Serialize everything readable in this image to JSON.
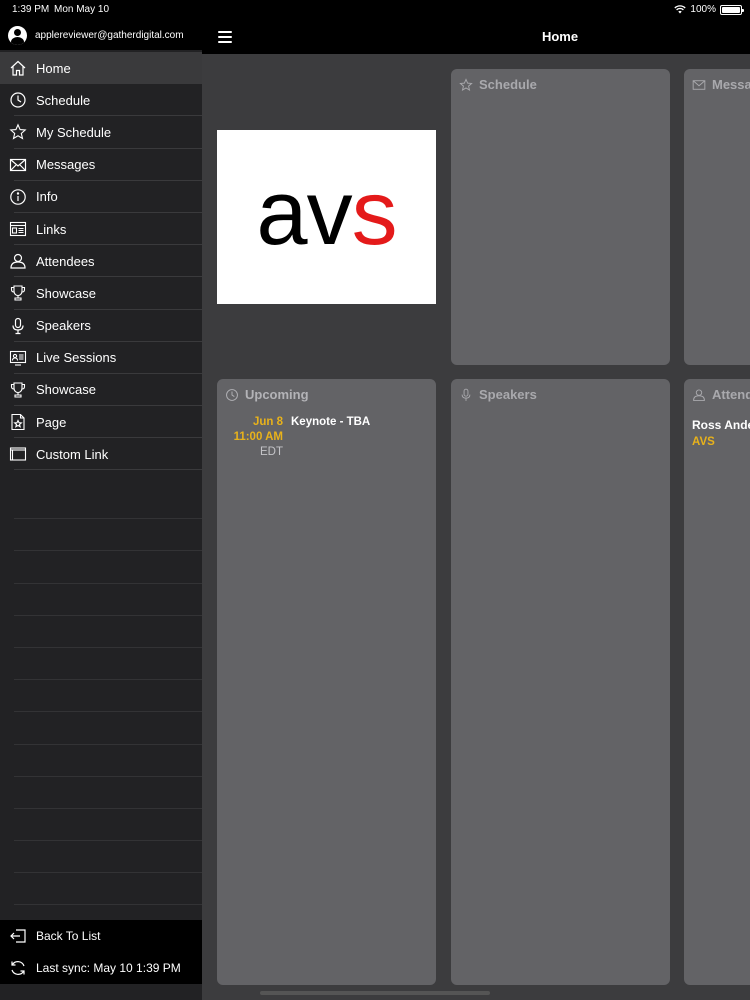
{
  "status_bar": {
    "time": "1:39 PM",
    "date": "Mon May 10",
    "battery": "100%",
    "battery_level": 1.0
  },
  "account": {
    "email": "applereviewer@gatherdigital.com"
  },
  "sidebar": {
    "items": [
      {
        "label": "Home",
        "icon": "home-icon"
      },
      {
        "label": "Schedule",
        "icon": "clock-icon"
      },
      {
        "label": "My Schedule",
        "icon": "star-icon"
      },
      {
        "label": "Messages",
        "icon": "envelope-icon"
      },
      {
        "label": "Info",
        "icon": "info-icon"
      },
      {
        "label": "Links",
        "icon": "links-icon"
      },
      {
        "label": "Attendees",
        "icon": "person-icon"
      },
      {
        "label": "Showcase",
        "icon": "trophy-icon"
      },
      {
        "label": "Speakers",
        "icon": "microphone-icon"
      },
      {
        "label": "Live Sessions",
        "icon": "presentation-icon"
      },
      {
        "label": "Showcase",
        "icon": "trophy-icon"
      },
      {
        "label": "Page",
        "icon": "page-icon"
      },
      {
        "label": "Custom Link",
        "icon": "window-icon"
      }
    ],
    "back_to_list": "Back To List",
    "last_sync_label": "Last sync:",
    "last_sync_value": "May 10 1:39 PM"
  },
  "header": {
    "title": "Home"
  },
  "logo": {
    "part1": "av",
    "part2": "s"
  },
  "cards": {
    "schedule": {
      "title": "Schedule"
    },
    "messages": {
      "title": "Messages"
    },
    "upcoming": {
      "title": "Upcoming",
      "events": [
        {
          "date": "Jun 8",
          "time": "11:00 AM",
          "tz": "EDT",
          "title": "Keynote - TBA"
        }
      ]
    },
    "speakers": {
      "title": "Speakers"
    },
    "attendees": {
      "title": "Attendees",
      "people": [
        {
          "name": "Ross Anderson",
          "company": "AVS"
        }
      ]
    }
  },
  "colors": {
    "accent": "#e8b21b",
    "logo_red": "#e41a1a"
  }
}
